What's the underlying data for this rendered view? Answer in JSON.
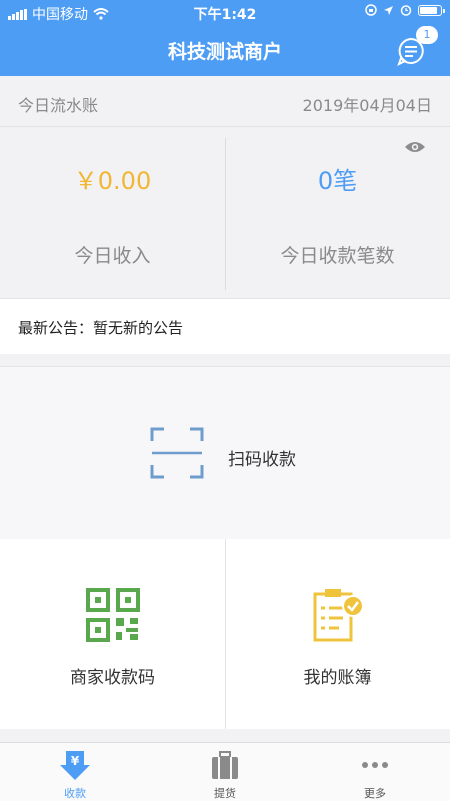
{
  "status_bar": {
    "carrier": "中国移动",
    "time": "下午1:42",
    "battery_level": 0.85
  },
  "header": {
    "title": "科技测试商户",
    "message_badge": "1"
  },
  "daily": {
    "label": "今日流水账",
    "date": "2019年04月04日"
  },
  "stats": {
    "income_value": "￥0.00",
    "income_label": "今日收入",
    "count_value": "0笔",
    "count_label": "今日收款笔数"
  },
  "notice": {
    "label": "最新公告：",
    "text": "暂无新的公告"
  },
  "actions": {
    "scan_label": "扫码收款",
    "merchant_qr_label": "商家收款码",
    "ledger_label": "我的账簿"
  },
  "tabs": [
    {
      "label": "收款",
      "icon": "yuan-download-icon",
      "active": true
    },
    {
      "label": "提货",
      "icon": "suitcase-icon",
      "active": false
    },
    {
      "label": "更多",
      "icon": "more-dots-icon",
      "active": false
    }
  ],
  "colors": {
    "primary": "#4e9df5",
    "income": "#f3b632",
    "count": "#4e9df5",
    "qr_green": "#5aa84e",
    "ledger_yellow": "#f0c33c",
    "scan_blue": "#6e9ccc"
  }
}
